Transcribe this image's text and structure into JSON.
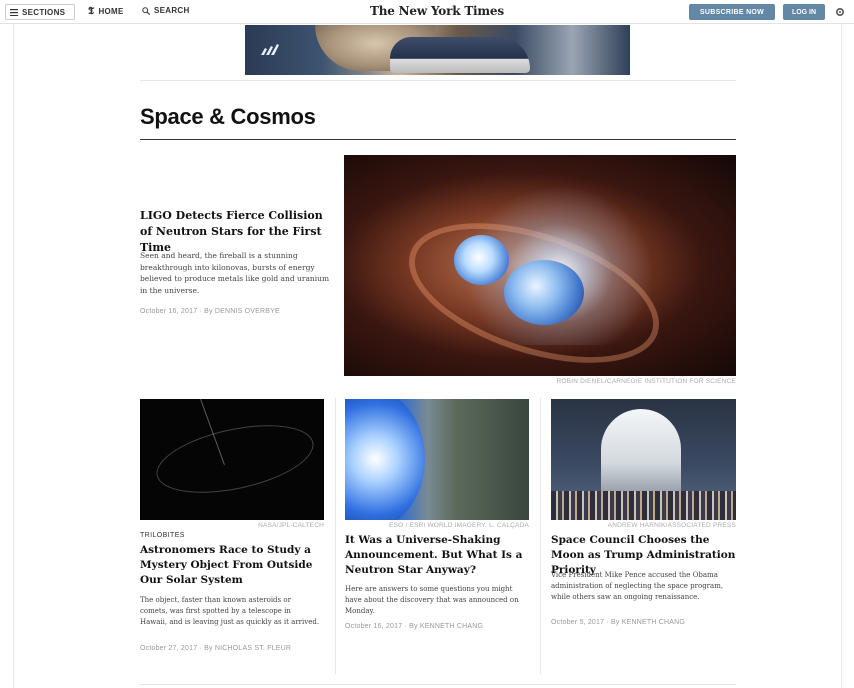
{
  "topbar": {
    "sections_label": "SECTIONS",
    "home_label": "HOME",
    "search_label": "SEARCH",
    "masthead": "The New York Times",
    "subscribe_label": "SUBSCRIBE NOW",
    "login_label": "LOG IN",
    "accent_color": "#6288a5"
  },
  "section": {
    "title": "Space & Cosmos"
  },
  "lead": {
    "title": "LIGO Detects Fierce Collision of Neutron Stars for the First Time",
    "summary": "Seen and heard, the fireball is a stunning breakthrough into kilonovas, bursts of energy believed to produce metals like gold and uranium in the universe.",
    "byline": "October 16, 2017 · By DENNIS OVERBYE",
    "credit": "ROBIN DIENEL/CARNEGIE INSTITUTION FOR SCIENCE"
  },
  "cards": [
    {
      "credit": "NASA/JPL-CALTECH",
      "kicker": "TRILOBITES",
      "title": "Astronomers Race to Study a Mystery Object From Outside Our Solar System",
      "summary": "The object, faster than known asteroids or comets, was first spotted by a telescope in Hawaii, and is leaving just as quickly as it arrived.",
      "byline": "October 27, 2017 · By NICHOLAS ST. FLEUR"
    },
    {
      "credit": "ESO / ESRI WORLD IMAGERY, L. CALÇADA",
      "title": "It Was a Universe-Shaking Announcement. But What Is a Neutron Star Anyway?",
      "summary": "Here are answers to some questions you might have about the discovery that was announced on Monday.",
      "byline": "October 16, 2017 · By KENNETH CHANG"
    },
    {
      "credit": "ANDREW HARNIK/ASSOCIATED PRESS",
      "title": "Space Council Chooses the Moon as Trump Administration Priority",
      "summary": "Vice President Mike Pence accused the Obama administration of neglecting the space program, while others saw an ongoing renaissance.",
      "byline": "October 5, 2017 · By KENNETH CHANG"
    }
  ]
}
